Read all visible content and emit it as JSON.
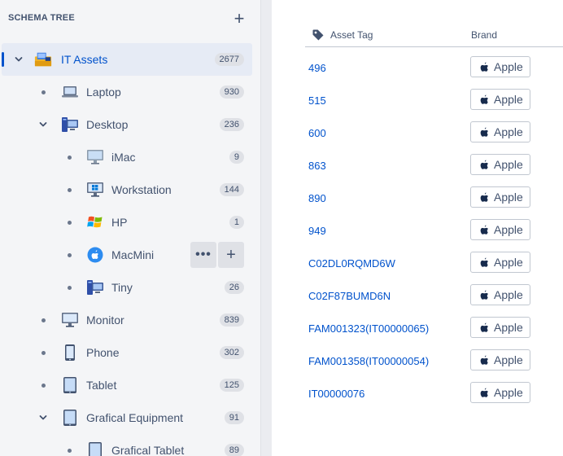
{
  "sidebar": {
    "title": "SCHEMA TREE",
    "add_glyph": "+",
    "more_glyph": "•••",
    "row_add_glyph": "+",
    "nodes": [
      {
        "label": "IT Assets",
        "count": "2677",
        "icon": "it-assets-icon",
        "level": 0,
        "expanded": true,
        "selected": true
      },
      {
        "label": "Laptop",
        "count": "930",
        "icon": "laptop-icon",
        "level": 1
      },
      {
        "label": "Desktop",
        "count": "236",
        "icon": "desktop-icon",
        "level": 1,
        "expanded": true
      },
      {
        "label": "iMac",
        "count": "9",
        "icon": "imac-icon",
        "level": 2
      },
      {
        "label": "Workstation",
        "count": "144",
        "icon": "workstation-icon",
        "level": 2
      },
      {
        "label": "HP",
        "count": "1",
        "icon": "windows-logo-icon",
        "level": 2
      },
      {
        "label": "MacMini",
        "count": "",
        "icon": "apple-logo-icon",
        "level": 2,
        "hovered": true
      },
      {
        "label": "Tiny",
        "count": "26",
        "icon": "desktop-icon",
        "level": 2
      },
      {
        "label": "Monitor",
        "count": "839",
        "icon": "monitor-icon",
        "level": 1
      },
      {
        "label": "Phone",
        "count": "302",
        "icon": "phone-icon",
        "level": 1
      },
      {
        "label": "Tablet",
        "count": "125",
        "icon": "tablet-icon",
        "level": 1
      },
      {
        "label": "Grafical Equipment",
        "count": "91",
        "icon": "tablet-icon",
        "level": 1,
        "expanded": true
      },
      {
        "label": "Grafical Tablet",
        "count": "89",
        "icon": "tablet-icon",
        "level": 2
      }
    ]
  },
  "table": {
    "headers": {
      "asset_tag": "Asset Tag",
      "brand": "Brand"
    },
    "rows": [
      {
        "asset_tag": "496",
        "brand": "Apple"
      },
      {
        "asset_tag": "515",
        "brand": "Apple"
      },
      {
        "asset_tag": "600",
        "brand": "Apple"
      },
      {
        "asset_tag": "863",
        "brand": "Apple"
      },
      {
        "asset_tag": "890",
        "brand": "Apple"
      },
      {
        "asset_tag": "949",
        "brand": "Apple"
      },
      {
        "asset_tag": "C02DL0RQMD6W",
        "brand": "Apple"
      },
      {
        "asset_tag": "C02F87BUMD6N",
        "brand": "Apple"
      },
      {
        "asset_tag": "FAM001323(IT00000065)",
        "brand": "Apple"
      },
      {
        "asset_tag": "FAM001358(IT00000054)",
        "brand": "Apple"
      },
      {
        "asset_tag": "IT00000076",
        "brand": "Apple"
      }
    ]
  },
  "colors": {
    "accent": "#0052cc",
    "selected_bg": "#e6ebf5",
    "sidebar_bg": "#f4f5f7"
  }
}
